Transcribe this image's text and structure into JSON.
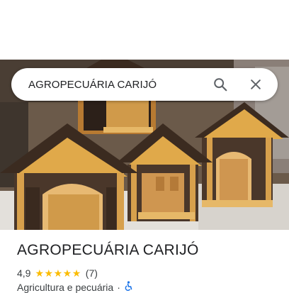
{
  "search": {
    "query": "AGROPECUÁRIA CARIJÓ"
  },
  "place": {
    "name": "AGROPECUÁRIA CARIJÓ",
    "rating": "4,9",
    "stars": 5,
    "review_count": "(7)",
    "category": "Agricultura e pecuária",
    "separator": "·"
  },
  "icons": {
    "search": "search-icon",
    "close": "close-icon",
    "accessibility": "wheelchair-icon"
  },
  "colors": {
    "star": "#fbbc04",
    "accessibility": "#1a73e8",
    "text": "#202124"
  }
}
